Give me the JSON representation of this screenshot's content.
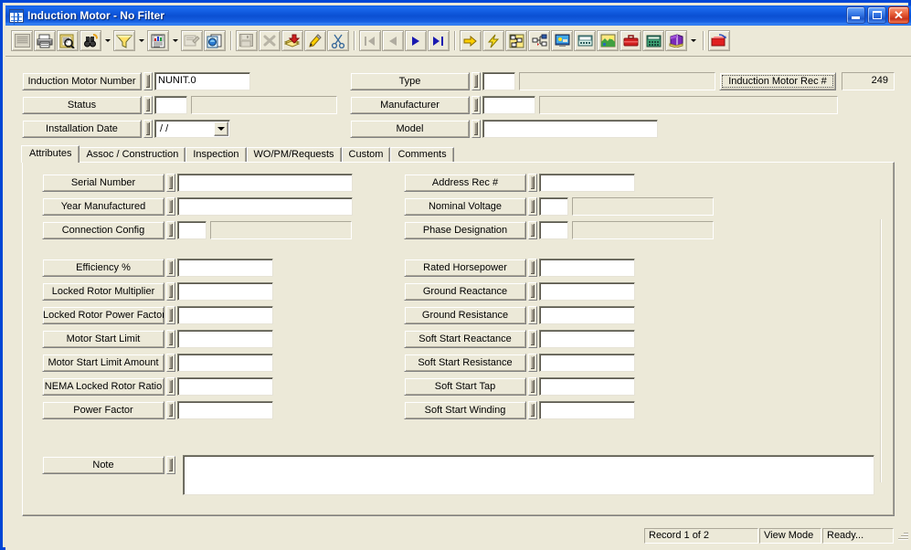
{
  "window": {
    "title": "Induction Motor  - No Filter",
    "icon": "grid-table-icon",
    "minimize_label": "_",
    "maximize_label": "□",
    "close_label": "✕",
    "accent_color": "#0046d5",
    "face_color": "#ece9d8"
  },
  "toolbar": {
    "groups": [
      {
        "items": [
          {
            "name": "new-record-icon",
            "enabled": false
          },
          {
            "name": "print-icon",
            "enabled": true
          },
          {
            "name": "print-preview-icon",
            "enabled": true
          },
          {
            "name": "find-binoculars-icon",
            "enabled": true
          },
          {
            "name": "find-dropdown-arrow",
            "enabled": true,
            "kind": "arrow"
          },
          {
            "name": "filter-funnel-icon",
            "enabled": true
          },
          {
            "name": "filter-dropdown-arrow",
            "enabled": true,
            "kind": "arrow"
          },
          {
            "name": "report-document-icon",
            "enabled": true
          },
          {
            "name": "report-dropdown-arrow",
            "enabled": true,
            "kind": "arrow"
          },
          {
            "name": "form-properties-icon",
            "enabled": false
          },
          {
            "name": "copy-record-icon",
            "enabled": true
          }
        ]
      },
      {
        "items": [
          {
            "name": "save-icon",
            "enabled": false
          },
          {
            "name": "delete-x-icon",
            "enabled": false
          },
          {
            "name": "add-record-icon",
            "enabled": true
          },
          {
            "name": "edit-pencil-icon",
            "enabled": true
          },
          {
            "name": "cut-scissors-icon",
            "enabled": true
          }
        ]
      },
      {
        "items": [
          {
            "name": "first-record-icon",
            "enabled": false
          },
          {
            "name": "previous-record-icon",
            "enabled": false
          },
          {
            "name": "next-record-icon",
            "enabled": true
          },
          {
            "name": "last-record-icon",
            "enabled": true
          }
        ]
      },
      {
        "items": [
          {
            "name": "goto-arrow-icon",
            "enabled": true
          },
          {
            "name": "lightning-bolt-icon",
            "enabled": true
          },
          {
            "name": "schematic-icon",
            "enabled": true
          },
          {
            "name": "hierarchy-tree-icon",
            "enabled": true
          },
          {
            "name": "monitor-display-icon",
            "enabled": true
          },
          {
            "name": "fax-machine-icon",
            "enabled": true
          },
          {
            "name": "map-image-icon",
            "enabled": true
          },
          {
            "name": "toolbox-icon",
            "enabled": true
          },
          {
            "name": "calculator-icon",
            "enabled": true
          },
          {
            "name": "book-help-icon",
            "enabled": true
          },
          {
            "name": "book-dropdown-arrow",
            "enabled": true,
            "kind": "arrow"
          }
        ]
      },
      {
        "items": [
          {
            "name": "export-red-icon",
            "enabled": true
          }
        ]
      }
    ]
  },
  "header": {
    "left_fields": [
      {
        "label": "Induction Motor Number",
        "value": "NUNIT.0",
        "type": "text"
      },
      {
        "label": "Status",
        "value": "",
        "code": "",
        "type": "code-desc"
      },
      {
        "label": "Installation Date",
        "value": "/  /",
        "type": "date"
      }
    ],
    "right_fields": [
      {
        "label": "Type",
        "value": "",
        "code": "",
        "type": "code-desc"
      },
      {
        "label": "Manufacturer",
        "value": "",
        "code": "",
        "type": "code-desc"
      },
      {
        "label": "Model",
        "value": "",
        "type": "text"
      }
    ],
    "record_button_label": "Induction Motor Rec #",
    "record_number": "249"
  },
  "tabs": [
    {
      "label": "Attributes",
      "active": true
    },
    {
      "label": "Assoc / Construction",
      "active": false
    },
    {
      "label": "Inspection",
      "active": false
    },
    {
      "label": "WO/PM/Requests",
      "active": false
    },
    {
      "label": "Custom",
      "active": false
    },
    {
      "label": "Comments",
      "active": false
    }
  ],
  "attributes": {
    "left_group_one": [
      {
        "label": "Serial Number",
        "value": "",
        "type": "text"
      },
      {
        "label": "Year Manufactured",
        "value": "",
        "type": "text"
      },
      {
        "label": "Connection Config",
        "value": "",
        "code": "",
        "type": "code-desc"
      }
    ],
    "left_group_two": [
      {
        "label": "Efficiency %",
        "value": "",
        "type": "text"
      },
      {
        "label": "Locked Rotor Multiplier",
        "value": "",
        "type": "text"
      },
      {
        "label": "Locked Rotor Power Factor",
        "value": "",
        "type": "text"
      },
      {
        "label": "Motor Start Limit",
        "value": "",
        "type": "text"
      },
      {
        "label": "Motor Start Limit Amount",
        "value": "",
        "type": "text"
      },
      {
        "label": "NEMA Locked Rotor Ratio",
        "value": "",
        "type": "text"
      },
      {
        "label": "Power Factor",
        "value": "",
        "type": "text"
      }
    ],
    "right_group_one": [
      {
        "label": "Address Rec #",
        "value": "",
        "type": "text"
      },
      {
        "label": "Nominal Voltage",
        "value": "",
        "code": "",
        "type": "code-desc"
      },
      {
        "label": "Phase Designation",
        "value": "",
        "code": "",
        "type": "code-desc"
      }
    ],
    "right_group_two": [
      {
        "label": "Rated Horsepower",
        "value": "",
        "type": "text"
      },
      {
        "label": "Ground Reactance",
        "value": "",
        "type": "text"
      },
      {
        "label": "Ground Resistance",
        "value": "",
        "type": "text"
      },
      {
        "label": "Soft Start Reactance",
        "value": "",
        "type": "text"
      },
      {
        "label": "Soft Start Resistance",
        "value": "",
        "type": "text"
      },
      {
        "label": "Soft Start Tap",
        "value": "",
        "type": "text"
      },
      {
        "label": "Soft Start Winding",
        "value": "",
        "type": "text"
      }
    ],
    "note": {
      "label": "Note",
      "value": ""
    }
  },
  "statusbar": {
    "record_position": "Record 1 of 2",
    "mode": "View Mode",
    "state": "Ready..."
  }
}
